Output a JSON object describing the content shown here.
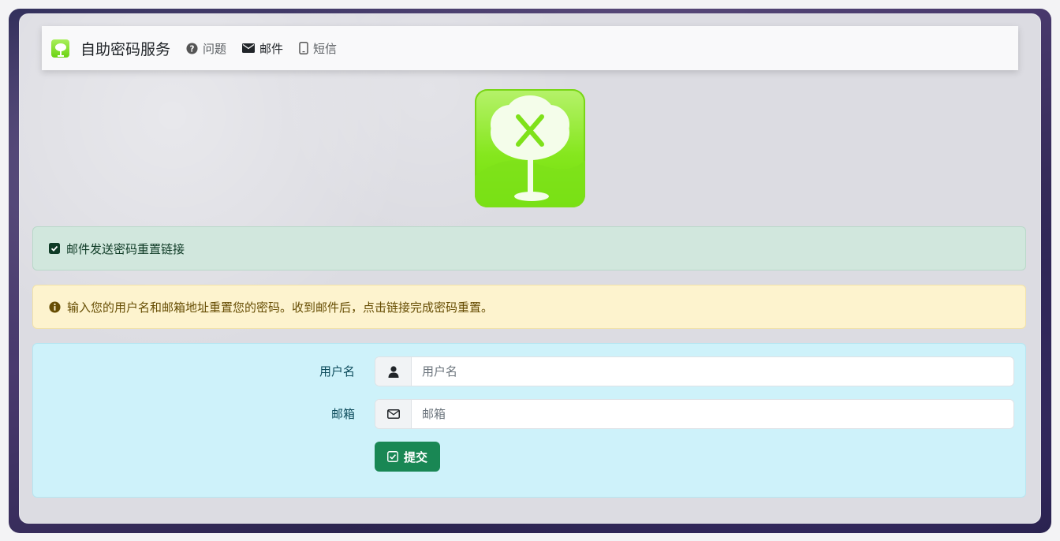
{
  "navbar": {
    "brand": "自助密码服务",
    "items": [
      {
        "label": "问题",
        "icon": "question-circle-icon"
      },
      {
        "label": "邮件",
        "icon": "envelope-icon"
      },
      {
        "label": "短信",
        "icon": "mobile-icon"
      }
    ]
  },
  "alerts": {
    "success": "邮件发送密码重置链接",
    "warning": "输入您的用户名和邮箱地址重置您的密码。收到邮件后，点击链接完成密码重置。"
  },
  "form": {
    "username_label": "用户名",
    "username_placeholder": "用户名",
    "email_label": "邮箱",
    "email_placeholder": "邮箱",
    "submit_label": "提交"
  },
  "colors": {
    "success_bg": "#d1e7dd",
    "warning_bg": "#fdf3ce",
    "form_bg": "#cef2fa",
    "button": "#198754",
    "logo_green": "#86e71e"
  }
}
